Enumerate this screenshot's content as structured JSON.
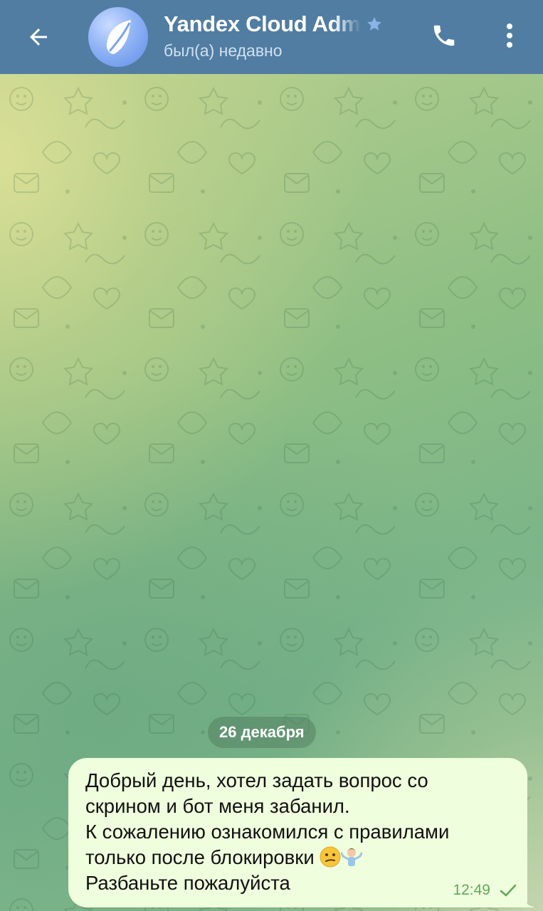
{
  "header": {
    "title": "Yandex Cloud Adm",
    "status": "был(а) недавно",
    "icons": {
      "back": "arrow-left-icon",
      "favorite": "star-icon",
      "call": "phone-icon",
      "menu": "more-vertical-icon"
    },
    "colors": {
      "background": "#517da2",
      "star": "#8ab4e8"
    }
  },
  "chat": {
    "date_separator": "26 декабря",
    "messages": [
      {
        "direction": "outgoing",
        "line1": "Добрый день, хотел задать вопрос со",
        "line2": "скрином и бот меня забанил.",
        "line3": "К сожалению ознакомился с правилами",
        "line4": "только после блокировки",
        "line5": "Разбаньте пожалуйста",
        "emojis": [
          "confused-face-emoji",
          "person-shrugging-emoji"
        ],
        "time": "12:49",
        "status_icon": "single-check-icon",
        "bubble_color": "#effedd",
        "meta_color": "#5fa95a"
      }
    ]
  }
}
